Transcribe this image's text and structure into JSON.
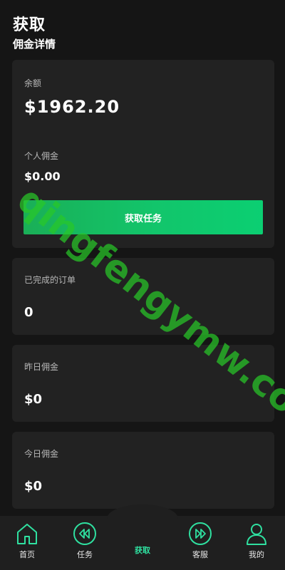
{
  "header": {
    "title": "获取",
    "subtitle": "佣金详情"
  },
  "balance_card": {
    "balance_label": "余额",
    "balance_value": "$1962.20",
    "commission_label": "个人佣金",
    "commission_value": "$0.00",
    "button_label": "获取任务"
  },
  "stats": {
    "completed_orders_label": "已完成的订单",
    "completed_orders_value": "0",
    "yesterday_label": "昨日佣金",
    "yesterday_value": "$0",
    "today_label": "今日佣金",
    "today_value": "$0"
  },
  "watermark": "qingfengymw.com",
  "nav": {
    "home": "首页",
    "tasks": "任务",
    "get": "获取",
    "service": "客服",
    "mine": "我的"
  },
  "colors": {
    "accent": "#12c56b",
    "nav_icon": "#2fe0a0",
    "card_bg": "#222222",
    "page_bg": "#151515"
  }
}
